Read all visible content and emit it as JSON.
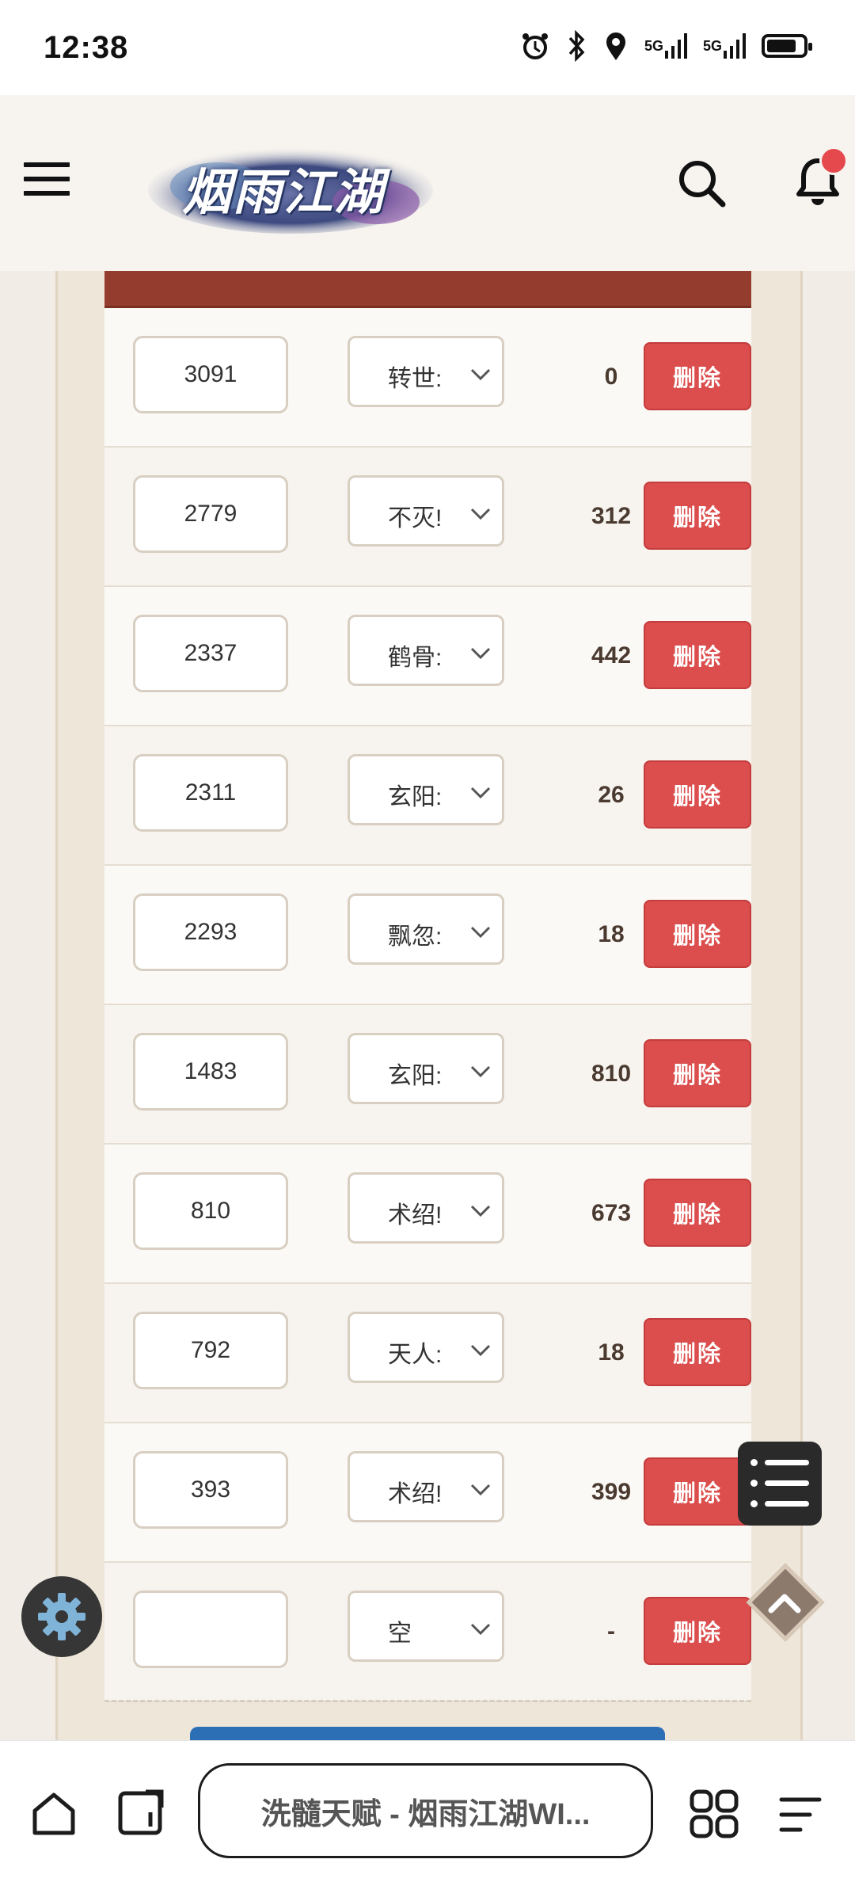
{
  "status": {
    "time": "12:38",
    "net1": "5G",
    "net2": "5G"
  },
  "header": {
    "logo_text": "烟雨江湖",
    "notification_dot": true
  },
  "table": {
    "rows": [
      {
        "input_value": "3091",
        "select_value": "转世:",
        "value": "0",
        "delete_label": "删除"
      },
      {
        "input_value": "2779",
        "select_value": "不灭!",
        "value": "312",
        "delete_label": "删除"
      },
      {
        "input_value": "2337",
        "select_value": "鹤骨:",
        "value": "442",
        "delete_label": "删除"
      },
      {
        "input_value": "2311",
        "select_value": "玄阳:",
        "value": "26",
        "delete_label": "删除"
      },
      {
        "input_value": "2293",
        "select_value": "飘忽:",
        "value": "18",
        "delete_label": "删除"
      },
      {
        "input_value": "1483",
        "select_value": "玄阳:",
        "value": "810",
        "delete_label": "删除"
      },
      {
        "input_value": "810",
        "select_value": "术绍!",
        "value": "673",
        "delete_label": "删除"
      },
      {
        "input_value": "792",
        "select_value": "天人:",
        "value": "18",
        "delete_label": "删除"
      },
      {
        "input_value": "393",
        "select_value": "术绍!",
        "value": "399",
        "delete_label": "删除"
      },
      {
        "input_value": "",
        "select_value": "空",
        "value": "-",
        "delete_label": "删除"
      }
    ]
  },
  "browser": {
    "url_title": "洗髓天赋 - 烟雨江湖WI..."
  },
  "icons": {
    "menu": "hamburger-icon",
    "search": "search-icon",
    "bell": "bell-icon",
    "toc": "toc-list-icon",
    "top": "back-to-top-icon",
    "gear": "gear-icon",
    "home": "home-icon",
    "tabs": "tabs-icon",
    "apps": "grid-icon",
    "more": "menu-icon"
  },
  "colors": {
    "header_bar": "#943d2e",
    "delete_button": "#dc4d4d",
    "primary_blue": "#2d6fb5",
    "notification": "#e5484d"
  }
}
